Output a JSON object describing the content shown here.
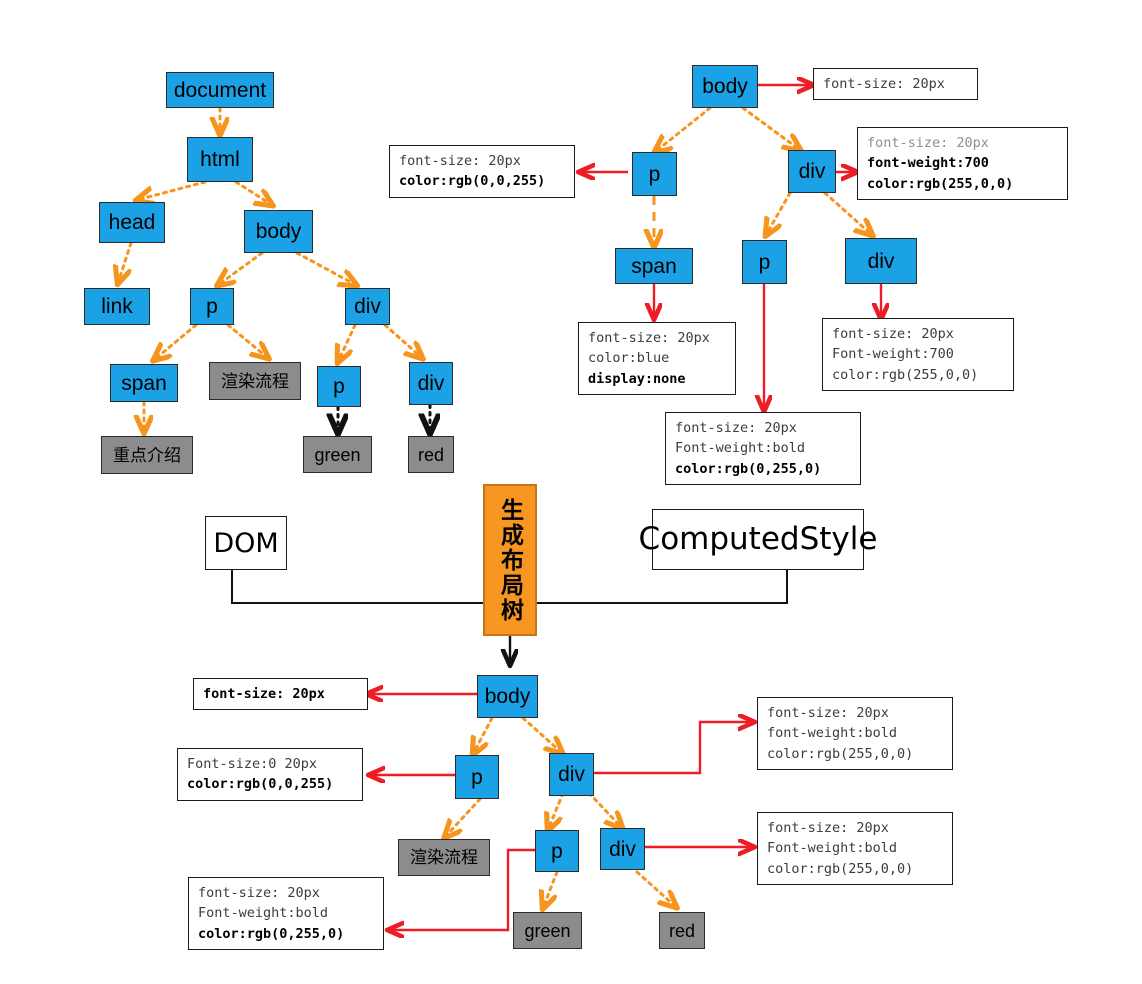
{
  "diagram": {
    "title": "DOM tree / ComputedStyle to layout tree",
    "colors": {
      "node_blue": "#1ba1e6",
      "node_grey": "#8c8c8c",
      "stage_orange": "#f79621",
      "dom_edge": "#f7941e",
      "style_edge": "#ee1c25",
      "text_edge": "#111111"
    }
  },
  "dom_tree": {
    "nodes": {
      "document": "document",
      "html": "html",
      "head": "head",
      "body": "body",
      "link": "link",
      "p": "p",
      "div": "div",
      "span": "span",
      "text_render_flow": "渲染流程",
      "text_key_intro": "重点介绍",
      "p2": "p",
      "div2": "div",
      "text_green": "green",
      "text_red": "red"
    }
  },
  "computed_style_tree": {
    "nodes": {
      "body": "body",
      "p": "p",
      "div": "div",
      "span": "span",
      "p2": "p",
      "div2": "div"
    },
    "boxes": {
      "body_style": {
        "lines": [
          "font-size: 20px"
        ]
      },
      "p_style": {
        "lines": [
          "font-size: 20px",
          "color:rgb(0,0,255)"
        ]
      },
      "div_style": {
        "lines": [
          "font-size: 20px",
          "font-weight:700",
          "color:rgb(255,0,0)"
        ]
      },
      "span_style": {
        "lines": [
          "font-size: 20px",
          "color:blue",
          "display:none"
        ]
      },
      "p2_style": {
        "lines": [
          "font-size: 20px",
          "Font-weight:bold",
          "color:rgb(0,255,0)"
        ]
      },
      "div2_style": {
        "lines": [
          "font-size: 20px",
          "Font-weight:700",
          "color:rgb(255,0,0)"
        ]
      }
    }
  },
  "stage": {
    "dom_label": "DOM",
    "computed_style_label": "ComputedStyle",
    "layout_tree_label": "生成布局树"
  },
  "layout_tree": {
    "nodes": {
      "body": "body",
      "p": "p",
      "div": "div",
      "text_render_flow": "渲染流程",
      "p2": "p",
      "div2": "div",
      "text_green": "green",
      "text_red": "red"
    },
    "boxes": {
      "body_style": {
        "lines": [
          "font-size: 20px"
        ]
      },
      "p_style": {
        "lines": [
          "Font-size:0 20px",
          "color:rgb(0,0,255)"
        ]
      },
      "div_style": {
        "lines": [
          "font-size: 20px",
          "font-weight:bold",
          "color:rgb(255,0,0)"
        ]
      },
      "p2_style": {
        "lines": [
          "font-size: 20px",
          "Font-weight:bold",
          "color:rgb(0,255,0)"
        ]
      },
      "div2_style": {
        "lines": [
          "font-size: 20px",
          "Font-weight:bold",
          "color:rgb(255,0,0)"
        ]
      }
    }
  }
}
